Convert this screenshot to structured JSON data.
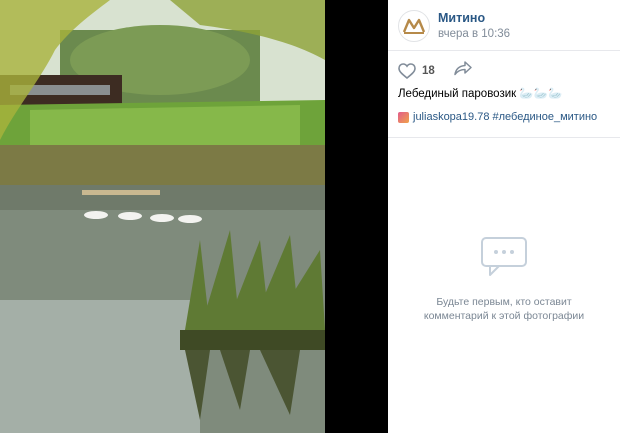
{
  "post": {
    "author": "Митино",
    "date": "вчера в 10:36",
    "likes": "18",
    "caption": "Лебединый паровозик 🦢🦢🦢",
    "tag_user": "juliaskopa19.78",
    "hashtag": "#лебединое_митино"
  },
  "comments": {
    "empty_line1": "Будьте первым, кто оставит",
    "empty_line2": "комментарий к этой фотографии"
  },
  "icons": {
    "like": "heart-icon",
    "share": "share-arrow-icon",
    "comments": "comment-bubble-icon"
  }
}
